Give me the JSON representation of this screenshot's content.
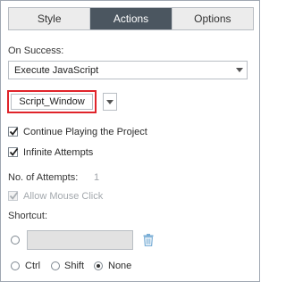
{
  "tabs": [
    {
      "label": "Style",
      "active": false
    },
    {
      "label": "Actions",
      "active": true
    },
    {
      "label": "Options",
      "active": false
    }
  ],
  "on_success": {
    "label": "On Success:",
    "value": "Execute JavaScript"
  },
  "script": {
    "window_label": "Script_Window"
  },
  "checkboxes": {
    "continue_playing": {
      "label": "Continue Playing the Project",
      "checked": true
    },
    "infinite_attempts": {
      "label": "Infinite Attempts",
      "checked": true
    },
    "allow_mouse_click": {
      "label": "Allow Mouse Click",
      "checked": true,
      "disabled": true
    }
  },
  "attempts": {
    "label": "No. of Attempts:",
    "value": "1"
  },
  "shortcut": {
    "label": "Shortcut:",
    "value": "",
    "modifiers": [
      {
        "label": "Ctrl",
        "checked": false
      },
      {
        "label": "Shift",
        "checked": false
      },
      {
        "label": "None",
        "checked": true
      }
    ]
  },
  "colors": {
    "active_tab": "#4b5660",
    "highlight_border": "#e0242a",
    "trash_icon": "#7aaed6"
  }
}
